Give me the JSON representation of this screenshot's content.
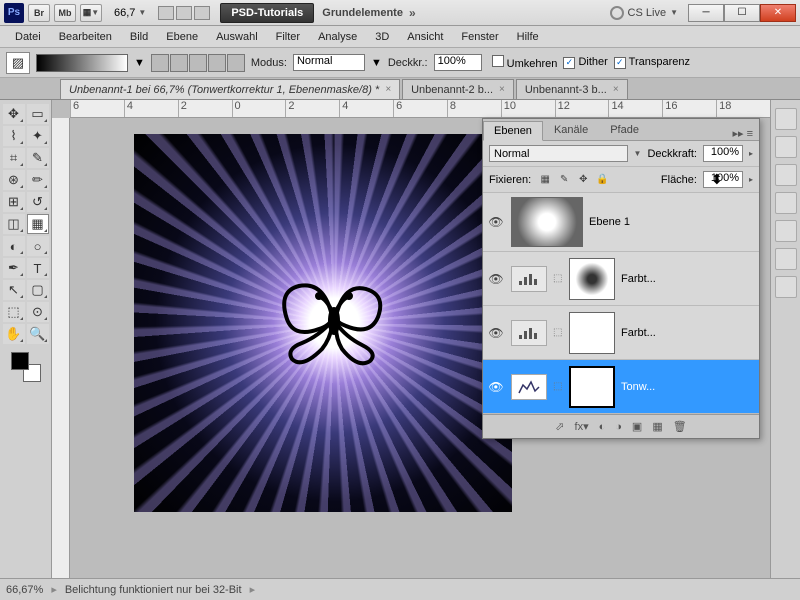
{
  "title": {
    "br": "Br",
    "mb": "Mb",
    "zoom": "66,7",
    "psd_tut": "PSD-Tutorials",
    "workspace": "Grundelemente",
    "cslive": "CS Live"
  },
  "menu": [
    "Datei",
    "Bearbeiten",
    "Bild",
    "Ebene",
    "Auswahl",
    "Filter",
    "Analyse",
    "3D",
    "Ansicht",
    "Fenster",
    "Hilfe"
  ],
  "opt": {
    "modus": "Modus:",
    "modus_val": "Normal",
    "deckkr": "Deckkr.:",
    "deckkr_val": "100%",
    "umkehren": "Umkehren",
    "dither": "Dither",
    "transparenz": "Transparenz"
  },
  "tabs": [
    {
      "label": "Unbenannt-1 bei 66,7% (Tonwertkorrektur 1, Ebenenmaske/8) *",
      "active": true
    },
    {
      "label": "Unbenannt-2 b...",
      "active": false
    },
    {
      "label": "Unbenannt-3 b...",
      "active": false
    }
  ],
  "ruler": [
    "6",
    "4",
    "2",
    "0",
    "2",
    "4",
    "6",
    "8",
    "10",
    "12",
    "14",
    "16",
    "18"
  ],
  "status": {
    "zoom": "66,67%",
    "msg": "Belichtung funktioniert nur bei 32-Bit"
  },
  "panel": {
    "tabs": [
      "Ebenen",
      "Kanäle",
      "Pfade"
    ],
    "blend": "Normal",
    "opacity_lbl": "Deckkraft:",
    "opacity": "100%",
    "lock_lbl": "Fixieren:",
    "fill_lbl": "Fläche:",
    "fill": "100%",
    "layers": [
      {
        "name": "Ebene 1",
        "type": "raster"
      },
      {
        "name": "Farbt...",
        "type": "adj"
      },
      {
        "name": "Farbt...",
        "type": "adj"
      },
      {
        "name": "Tonw...",
        "type": "adj",
        "sel": true
      }
    ]
  }
}
